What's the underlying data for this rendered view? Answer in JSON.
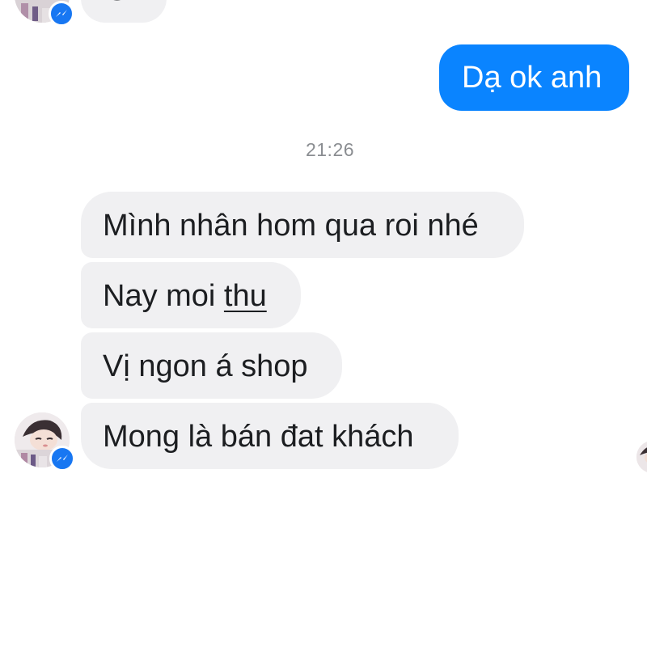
{
  "conversation": {
    "partial_top_message": "Ok",
    "sent_message": "Dạ ok anh",
    "timestamp": "21:26",
    "received_messages": [
      {
        "before": "Mình nhân hom qua roi nhé",
        "underlined": "",
        "after": ""
      },
      {
        "before": "Nay moi ",
        "underlined": "thu",
        "after": ""
      },
      {
        "before": "Vị ngon á shop",
        "underlined": "",
        "after": ""
      },
      {
        "before": "Mong là bán đat khách",
        "underlined": "",
        "after": ""
      }
    ]
  },
  "colors": {
    "sent_bubble": "#0a84ff",
    "received_bubble": "#f0f0f2",
    "timestamp_text": "#8a8d91",
    "messenger_badge": "#1877f2"
  },
  "icons": {
    "avatar": "contact-avatar-photo",
    "badge": "messenger-logo-icon"
  }
}
